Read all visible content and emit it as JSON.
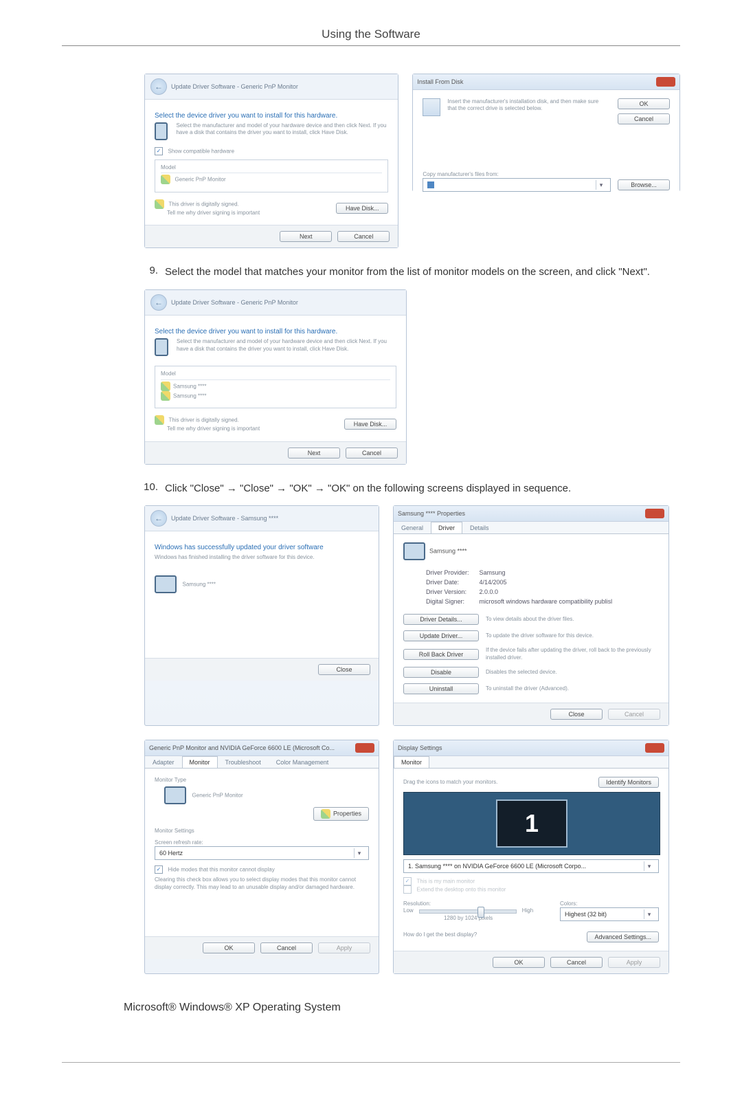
{
  "page": {
    "title": "Using the Software"
  },
  "step9": {
    "num": "9.",
    "text": "Select the model that matches your monitor from the list of monitor models on the screen, and click \"Next\"."
  },
  "step10": {
    "num": "10.",
    "text": "Click \"Close\" → \"Close\" → \"OK\" → \"OK\" on the following screens displayed in sequence."
  },
  "footer_line": "Microsoft® Windows® XP Operating System",
  "wiz1": {
    "crumb": "Update Driver Software - Generic PnP Monitor",
    "header": "Select the device driver you want to install for this hardware.",
    "hint": "Select the manufacturer and model of your hardware device and then click Next. If you have a disk that contains the driver you want to install, click Have Disk.",
    "show_compat": "Show compatible hardware",
    "col_model": "Model",
    "item1": "Generic PnP Monitor",
    "signed": "This driver is digitally signed.",
    "tell_link": "Tell me why driver signing is important",
    "have_disk": "Have Disk...",
    "next": "Next",
    "cancel": "Cancel"
  },
  "fromdisk": {
    "title": "Install From Disk",
    "hint": "Insert the manufacturer's installation disk, and then make sure that the correct drive is selected below.",
    "copy_label": "Copy manufacturer's files from:",
    "ok": "OK",
    "cancel": "Cancel",
    "browse": "Browse..."
  },
  "wiz2": {
    "crumb": "Update Driver Software - Generic PnP Monitor",
    "header": "Select the device driver you want to install for this hardware.",
    "hint": "Select the manufacturer and model of your hardware device and then click Next. If you have a disk that contains the driver you want to install, click Have Disk.",
    "col_model": "Model",
    "item1": "Samsung ****",
    "item2": "Samsung ****",
    "signed": "This driver is digitally signed.",
    "tell_link": "Tell me why driver signing is important",
    "have_disk": "Have Disk...",
    "next": "Next",
    "cancel": "Cancel"
  },
  "wiz3": {
    "crumb": "Update Driver Software - Samsung ****",
    "header": "Windows has successfully updated your driver software",
    "hint": "Windows has finished installing the driver software for this device.",
    "item1": "Samsung ****",
    "close": "Close"
  },
  "props": {
    "title": "Samsung **** Properties",
    "tab_general": "General",
    "tab_driver": "Driver",
    "tab_details": "Details",
    "name": "Samsung ****",
    "lbl_provider": "Driver Provider:",
    "val_provider": "Samsung",
    "lbl_date": "Driver Date:",
    "val_date": "4/14/2005",
    "lbl_version": "Driver Version:",
    "val_version": "2.0.0.0",
    "lbl_signer": "Digital Signer:",
    "val_signer": "microsoft windows hardware compatibility publisl",
    "btn_details": "Driver Details...",
    "txt_details": "To view details about the driver files.",
    "btn_update": "Update Driver...",
    "txt_update": "To update the driver software for this device.",
    "btn_rollback": "Roll Back Driver",
    "txt_rollback": "If the device fails after updating the driver, roll back to the previously installed driver.",
    "btn_disable": "Disable",
    "txt_disable": "Disables the selected device.",
    "btn_uninstall": "Uninstall",
    "txt_uninstall": "To uninstall the driver (Advanced).",
    "close": "Close",
    "cancel": "Cancel"
  },
  "monprops": {
    "title": "Generic PnP Monitor and NVIDIA GeForce 6600 LE (Microsoft Co...",
    "tab_adapter": "Adapter",
    "tab_monitor": "Monitor",
    "tab_ts": "Troubleshoot",
    "tab_cm": "Color Management",
    "sect1": "Monitor Type",
    "type_val": "Generic PnP Monitor",
    "btn_props": "Properties",
    "sect2": "Monitor Settings",
    "lbl_refresh": "Screen refresh rate:",
    "refresh_val": "60 Hertz",
    "chk": "Hide modes that this monitor cannot display",
    "chk_hint": "Clearing this check box allows you to select display modes that this monitor cannot display correctly. This may lead to an unusable display and/or damaged hardware.",
    "ok": "OK",
    "cancel": "Cancel",
    "apply": "Apply"
  },
  "display": {
    "title": "Display Settings",
    "tab_monitor": "Monitor",
    "drag": "Drag the icons to match your monitors.",
    "identify": "Identify Monitors",
    "monitor_num": "1",
    "sel_monitor": "1. Samsung **** on NVIDIA GeForce 6600 LE (Microsoft Corpo...",
    "main_chk": "This is my main monitor",
    "extend_chk": "Extend the desktop onto this monitor",
    "lbl_res": "Resolution:",
    "low": "Low",
    "high": "High",
    "res_val": "1280 by 1024 pixels",
    "lbl_colors": "Colors:",
    "colors_val": "Highest (32 bit)",
    "best_link": "How do I get the best display?",
    "adv": "Advanced Settings...",
    "ok": "OK",
    "cancel": "Cancel",
    "apply": "Apply"
  }
}
